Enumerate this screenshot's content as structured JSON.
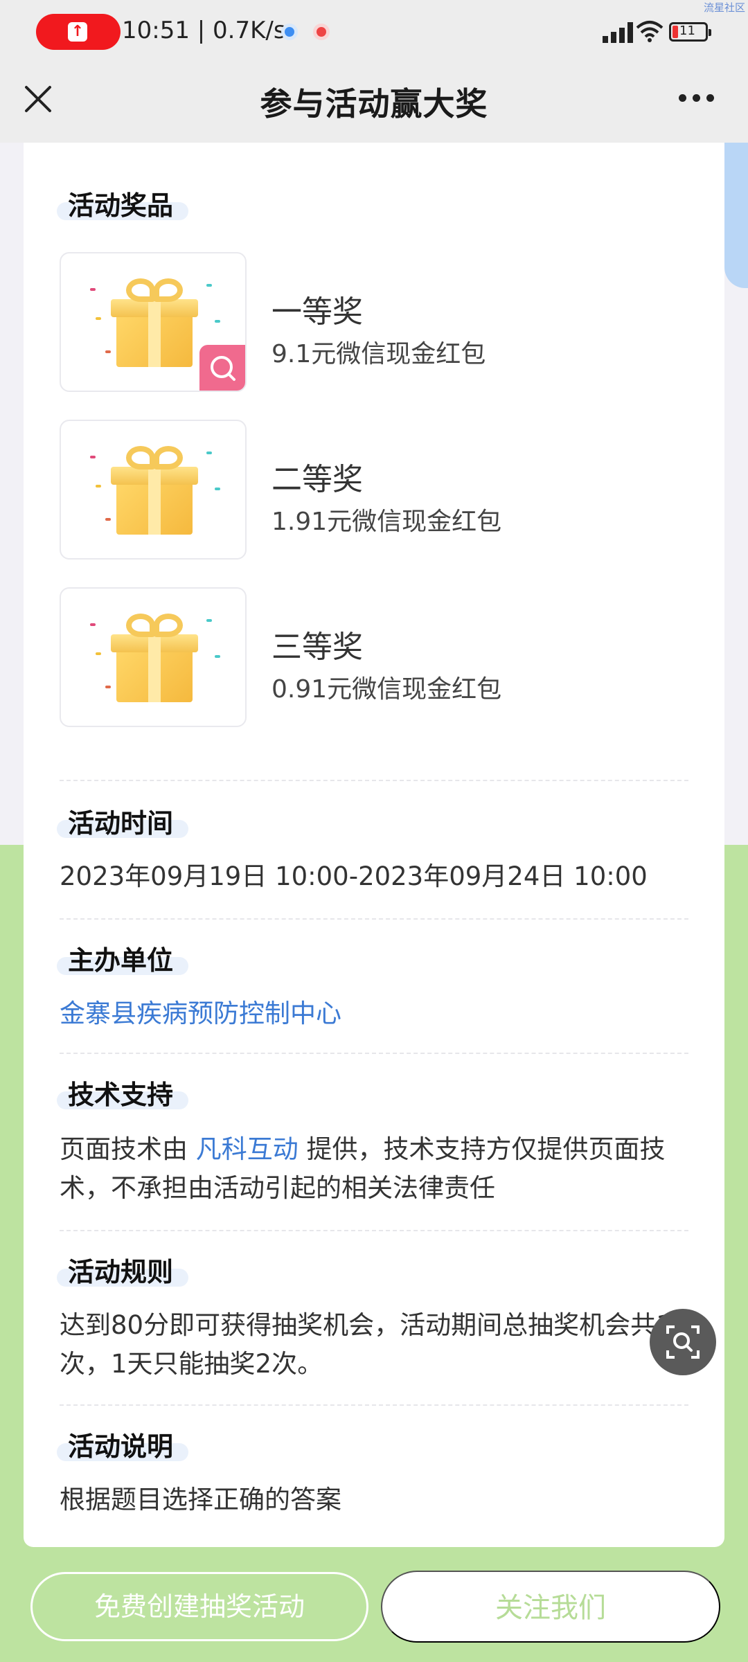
{
  "status_bar": {
    "time_speed": "10:51 | 0.7K/s",
    "battery": "11"
  },
  "watermark": "流星社区",
  "nav": {
    "title": "参与活动赢大奖"
  },
  "prizes_section": {
    "heading": "活动奖品",
    "items": [
      {
        "name": "一等奖",
        "desc": "9.1元微信现金红包"
      },
      {
        "name": "二等奖",
        "desc": "1.91元微信现金红包"
      },
      {
        "name": "三等奖",
        "desc": "0.91元微信现金红包"
      }
    ]
  },
  "time_section": {
    "heading": "活动时间",
    "value": "2023年09月19日 10:00-2023年09月24日 10:00"
  },
  "organizer_section": {
    "heading": "主办单位",
    "value": "金寨县疾病预防控制中心"
  },
  "tech_section": {
    "heading": "技术支持",
    "prefix": "页面技术由 ",
    "link": "凡科互动",
    "suffix": " 提供，技术支持方仅提供页面技术，不承担由活动引起的相关法律责任"
  },
  "rules_section": {
    "heading": "活动规则",
    "value": "达到80分即可获得抽奖机会，活动期间总抽奖机会共10次，1天只能抽奖2次。"
  },
  "desc_section": {
    "heading": "活动说明",
    "value": "根据题目选择正确的答案"
  },
  "buttons": {
    "create": "免费创建抽奖活动",
    "follow": "关注我们"
  }
}
